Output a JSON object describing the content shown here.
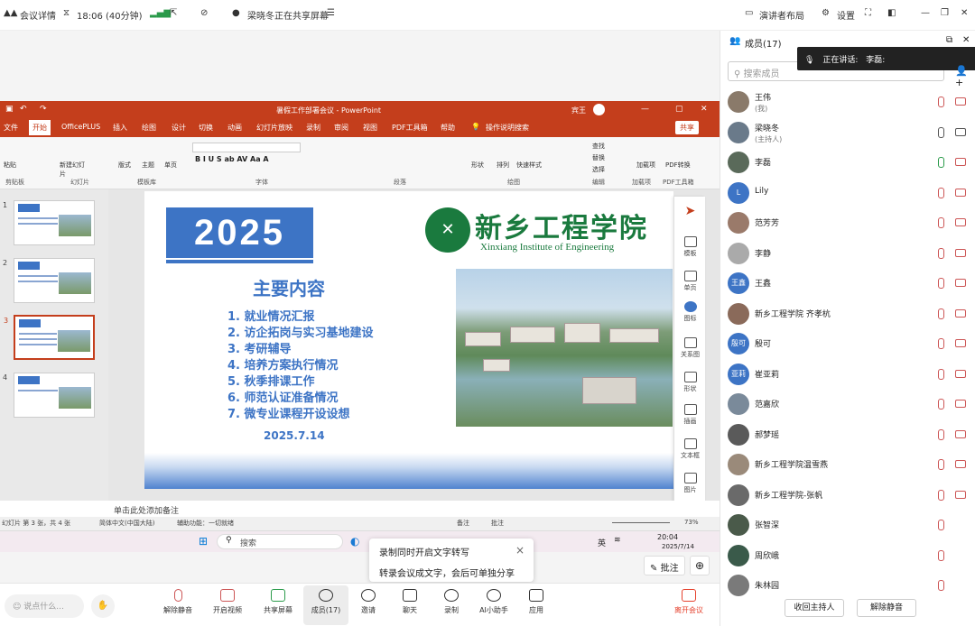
{
  "topbar": {
    "meeting_details": "会议详情",
    "time": "18:06 (40分钟)",
    "sharing": "梁晓冬正在共享屏幕",
    "layout": "演讲者布局",
    "settings": "设置"
  },
  "ppt": {
    "title": "暑假工作部署会议 - PowerPoint",
    "user": "宾王",
    "share": "共享",
    "tabs": [
      "文件",
      "开始",
      "OfficePLUS",
      "插入",
      "绘图",
      "设计",
      "切换",
      "动画",
      "幻灯片放映",
      "录制",
      "审阅",
      "视图",
      "PDF工具箱",
      "帮助"
    ],
    "tell_me": "操作说明搜索",
    "ribbon": {
      "paste": "粘贴",
      "new_slide": "新建幻灯片",
      "layout": "版式",
      "theme": "主题",
      "single_page": "单页",
      "shape": "形状",
      "arrange": "排列",
      "quick_styles": "快速样式",
      "find": "查找",
      "replace": "替换",
      "select": "选择",
      "addin": "加载项",
      "pdf_convert": "PDF转换",
      "groups": [
        "剪贴板",
        "幻灯片",
        "模板库",
        "字体",
        "段落",
        "绘图",
        "编辑",
        "加载项",
        "PDF工具箱"
      ]
    },
    "thumb_numbers": [
      "1",
      "2",
      "3",
      "4"
    ],
    "slide": {
      "year": "2025",
      "school_cn": "新乡工程学院",
      "school_en": "Xinxiang Institute of Engineering",
      "heading": "主要内容",
      "items": [
        "1.  就业情况汇报",
        "2.  访企拓岗与实习基地建设",
        "3.  考研辅导",
        "4.  培养方案执行情况",
        "5.  秋季排课工作",
        "6.  师范认证准备情况",
        "7.  微专业课程开设设想"
      ],
      "date": "2025.7.14"
    },
    "tools": [
      "模板",
      "单页",
      "图标",
      "关系图",
      "形状",
      "插画",
      "文本框",
      "图片"
    ],
    "notes": "单击此处添加备注",
    "status": {
      "slide_count": "幻灯片 第 3 张，共 4 张",
      "lang": "简体中文(中国大陆)",
      "access": "辅助功能：一切就绪",
      "notes": "备注",
      "comments": "批注",
      "zoom": "73%"
    },
    "taskbar": {
      "search": "搜索",
      "ime": "英",
      "time": "20:04",
      "date": "2025/7/14"
    }
  },
  "popup": {
    "title": "录制同时开启文字转写",
    "body": "转录会议成文字，会后可单独分享",
    "close": "×"
  },
  "annotate": "批注",
  "bottombar": {
    "chat_placeholder": "说点什么...",
    "buttons": [
      "解除静音",
      "开启视频",
      "共享屏幕",
      "成员(17)",
      "邀请",
      "聊天",
      "录制",
      "AI小助手",
      "应用"
    ],
    "leave": "离开会议"
  },
  "panel": {
    "title": "成员(17)",
    "search_placeholder": "搜索成员",
    "speaking_label": "正在讲话:",
    "speaking_name": "李磊:",
    "members": [
      {
        "name": "王伟",
        "sub": "(我)",
        "avatar": "",
        "color": "#8a7a6a"
      },
      {
        "name": "梁晓冬",
        "sub": "(主持人)",
        "avatar": "",
        "color": "#6a7a8a"
      },
      {
        "name": "李磊",
        "sub": "",
        "avatar": "",
        "color": "#5a6a5a"
      },
      {
        "name": "Lily",
        "sub": "",
        "avatar": "L",
        "color": "#3d74c5"
      },
      {
        "name": "范芳芳",
        "sub": "",
        "avatar": "",
        "color": "#9a7a6a"
      },
      {
        "name": "李静",
        "sub": "",
        "avatar": "",
        "color": "#aaaaaa"
      },
      {
        "name": "王鑫",
        "sub": "",
        "avatar": "王鑫",
        "color": "#3d74c5"
      },
      {
        "name": "新乡工程学院 齐孝杭",
        "sub": "",
        "avatar": "",
        "color": "#8a6a5a"
      },
      {
        "name": "殷可",
        "sub": "",
        "avatar": "殷可",
        "color": "#3d74c5"
      },
      {
        "name": "崔亚莉",
        "sub": "",
        "avatar": "亚莉",
        "color": "#3d74c5"
      },
      {
        "name": "范嘉欣",
        "sub": "",
        "avatar": "",
        "color": "#7a8a9a"
      },
      {
        "name": "郝梦瑶",
        "sub": "",
        "avatar": "",
        "color": "#5a5a5a"
      },
      {
        "name": "新乡工程学院温雪燕",
        "sub": "",
        "avatar": "",
        "color": "#9a8a7a"
      },
      {
        "name": "新乡工程学院-张帆",
        "sub": "",
        "avatar": "",
        "color": "#6a6a6a"
      },
      {
        "name": "张智深",
        "sub": "",
        "avatar": "",
        "color": "#4a5a4a"
      },
      {
        "name": "周欣峨",
        "sub": "",
        "avatar": "",
        "color": "#3a5a4a"
      },
      {
        "name": "朱林园",
        "sub": "",
        "avatar": "",
        "color": "#7a7a7a"
      }
    ],
    "recall_host": "收回主持人",
    "unmute_all": "解除静音"
  }
}
